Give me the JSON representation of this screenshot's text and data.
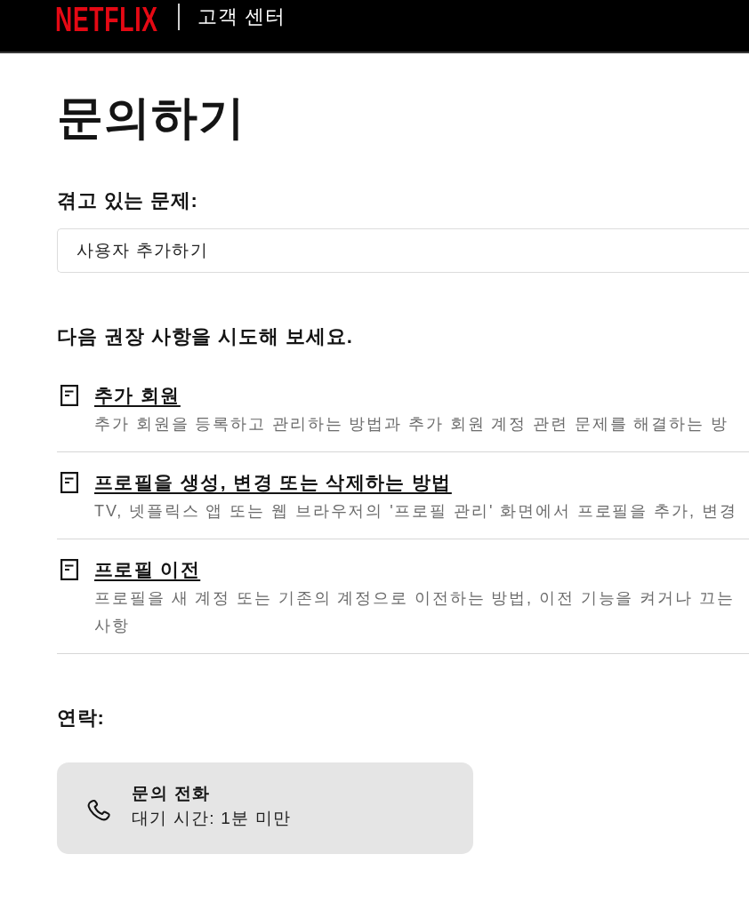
{
  "header": {
    "logo": "NETFLIX",
    "section": "고객 센터"
  },
  "page_title": "문의하기",
  "issue": {
    "label": "겪고 있는 문제:",
    "value": "사용자 추가하기"
  },
  "recommendations": {
    "heading": "다음 권장 사항을 시도해 보세요.",
    "articles": [
      {
        "title": "추가 회원",
        "description": "추가 회원을 등록하고 관리하는 방법과 추가 회원 계정 관련 문제를 해결하는 방"
      },
      {
        "title": "프로필을 생성, 변경 또는 삭제하는 방법",
        "description": "TV, 넷플릭스 앱 또는 웹 브라우저의 '프로필 관리' 화면에서 프로필을 추가, 변경"
      },
      {
        "title": "프로필 이전",
        "description": "프로필을 새 계정 또는 기존의 계정으로 이전하는 방법, 이전 기능을 켜거나 끄는\n사항"
      }
    ]
  },
  "contact": {
    "heading": "연락:",
    "options": [
      {
        "kind": "phone",
        "title": "문의 전화",
        "wait": "대기 시간: 1분 미만"
      }
    ]
  }
}
